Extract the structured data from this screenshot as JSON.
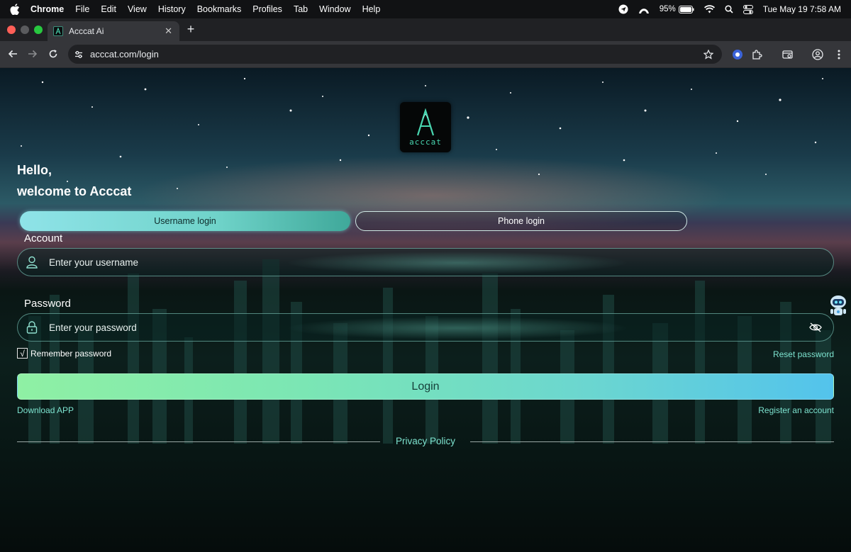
{
  "menubar": {
    "app_name": "Chrome",
    "items": [
      "File",
      "Edit",
      "View",
      "History",
      "Bookmarks",
      "Profiles",
      "Tab",
      "Window",
      "Help"
    ],
    "battery": "95%",
    "datetime": "Tue May 19  7:58 AM"
  },
  "browser": {
    "tab_title": "Acccat Ai",
    "url": "acccat.com/login"
  },
  "page": {
    "logo_text": "acccat",
    "greeting_line1": "Hello,",
    "greeting_line2": "welcome to Acccat",
    "tabs": {
      "username": "Username login",
      "phone": "Phone login",
      "active": "username"
    },
    "account_label": "Account",
    "username_placeholder": "Enter your username",
    "password_label": "Password",
    "password_placeholder": "Enter your password",
    "remember_label": "Remember password",
    "remember_checked": true,
    "reset_link": "Reset password",
    "login_button": "Login",
    "download_link": "Download APP",
    "register_link": "Register an account",
    "privacy_link": "Privacy Policy"
  },
  "colors": {
    "accent_link": "#7de3cf",
    "login_gradient_start": "#8ff0a4",
    "login_gradient_end": "#53c3ec",
    "active_tab": "#8fe3e8"
  }
}
